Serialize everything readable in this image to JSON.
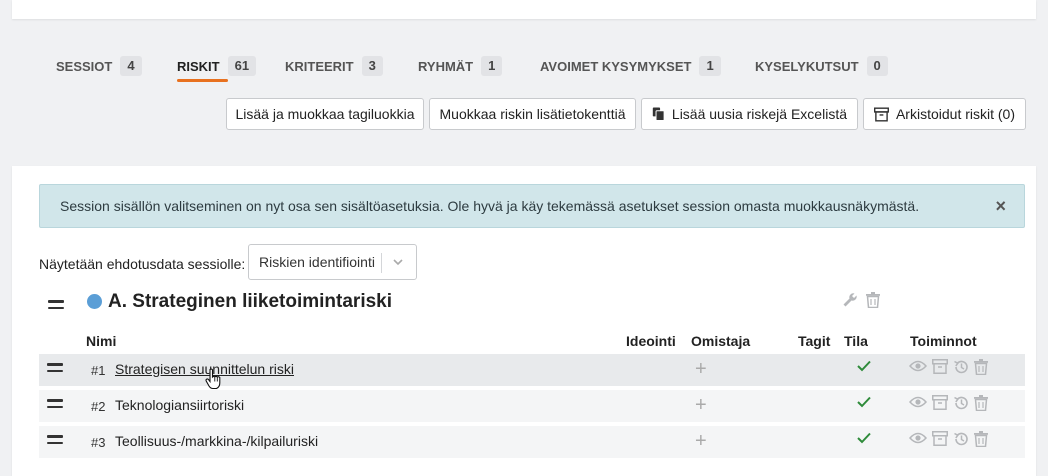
{
  "tabs": [
    {
      "label": "SESSIOT",
      "count": "4"
    },
    {
      "label": "RISKIT",
      "count": "61"
    },
    {
      "label": "KRITEERIT",
      "count": "3"
    },
    {
      "label": "RYHMÄT",
      "count": "1"
    },
    {
      "label": "AVOIMET KYSYMYKSET",
      "count": "1"
    },
    {
      "label": "KYSELYKUTSUT",
      "count": "0"
    }
  ],
  "toolbar": {
    "tag_classes_label": "Lisää ja muokkaa tagiluokkia",
    "extra_fields_label": "Muokkaa riskin lisätietokenttiä",
    "excel_import_label": "Lisää uusia riskejä Excelistä",
    "archived_label": "Arkistoidut riskit (0)"
  },
  "alert": {
    "text": "Session sisällön valitseminen on nyt osa sen sisältöasetuksia. Ole hyvä ja käy tekemässä asetukset session omasta muokkausnäkymästä.",
    "close": "×"
  },
  "session_filter": {
    "label": "Näytetään ehdotusdata sessiolle:",
    "selected": "Riskien identifiointi"
  },
  "group": {
    "title": "A. Strateginen liiketoimintariski",
    "color": "#5b9ed6"
  },
  "columns": {
    "name": "Nimi",
    "ideas": "Ideointi",
    "owner": "Omistaja",
    "tags": "Tagit",
    "status": "Tila",
    "actions": "Toiminnot"
  },
  "rows": [
    {
      "num": "#1",
      "name": "Strategisen suunnittelun riski",
      "add": "+"
    },
    {
      "num": "#2",
      "name": "Teknologiansiirtoriski",
      "add": "+"
    },
    {
      "num": "#3",
      "name": "Teollisuus-/markkina-/kilpailuriski",
      "add": "+"
    }
  ],
  "colors": {
    "accent": "#e8711f",
    "status_ok": "#2e8b3a"
  }
}
